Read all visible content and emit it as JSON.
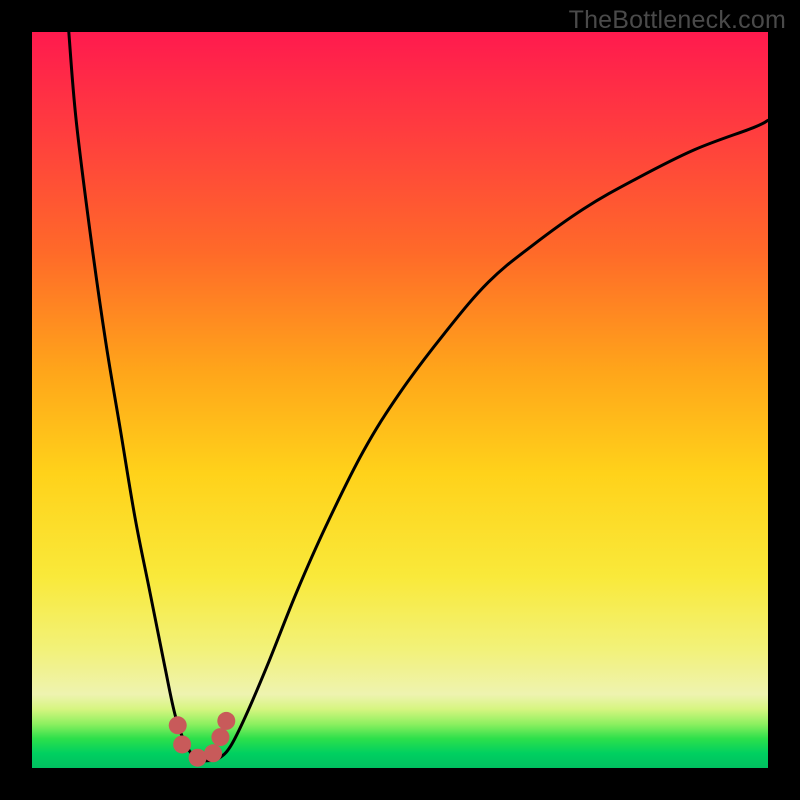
{
  "watermark": "TheBottleneck.com",
  "chart_data": {
    "type": "line",
    "title": "",
    "xlabel": "",
    "ylabel": "",
    "xlim": [
      0,
      100
    ],
    "ylim": [
      0,
      100
    ],
    "series": [
      {
        "name": "curve",
        "x": [
          5,
          6,
          8,
          10,
          12,
          14,
          16,
          18,
          19.5,
          21,
          22.5,
          24,
          25.5,
          27,
          29,
          32,
          36,
          40,
          45,
          50,
          56,
          62,
          68,
          75,
          82,
          90,
          98,
          100
        ],
        "y": [
          100,
          88,
          72,
          58,
          46,
          34,
          24,
          14,
          7,
          3,
          1.2,
          1.0,
          1.4,
          3,
          7,
          14,
          24,
          33,
          43,
          51,
          59,
          66,
          71,
          76,
          80,
          84,
          87,
          88
        ]
      }
    ],
    "markers": {
      "name": "bottom-markers",
      "color": "#c85a5a",
      "radius_px": 9,
      "points": [
        {
          "x": 19.8,
          "y": 5.8
        },
        {
          "x": 20.4,
          "y": 3.2
        },
        {
          "x": 22.5,
          "y": 1.4
        },
        {
          "x": 24.6,
          "y": 2.0
        },
        {
          "x": 25.6,
          "y": 4.2
        },
        {
          "x": 26.4,
          "y": 6.4
        }
      ]
    },
    "gradient_stops": [
      {
        "pos": 0.0,
        "color": "#ff1a4e"
      },
      {
        "pos": 0.14,
        "color": "#ff3e3e"
      },
      {
        "pos": 0.3,
        "color": "#ff6a29"
      },
      {
        "pos": 0.46,
        "color": "#ffa51a"
      },
      {
        "pos": 0.6,
        "color": "#ffd21a"
      },
      {
        "pos": 0.74,
        "color": "#f9e93a"
      },
      {
        "pos": 0.84,
        "color": "#f2f27a"
      },
      {
        "pos": 0.9,
        "color": "#eef3b0"
      },
      {
        "pos": 0.92,
        "color": "#d6f580"
      },
      {
        "pos": 0.94,
        "color": "#8ef060"
      },
      {
        "pos": 0.96,
        "color": "#2de04b"
      },
      {
        "pos": 0.98,
        "color": "#00d060"
      },
      {
        "pos": 1.0,
        "color": "#00c060"
      }
    ]
  }
}
